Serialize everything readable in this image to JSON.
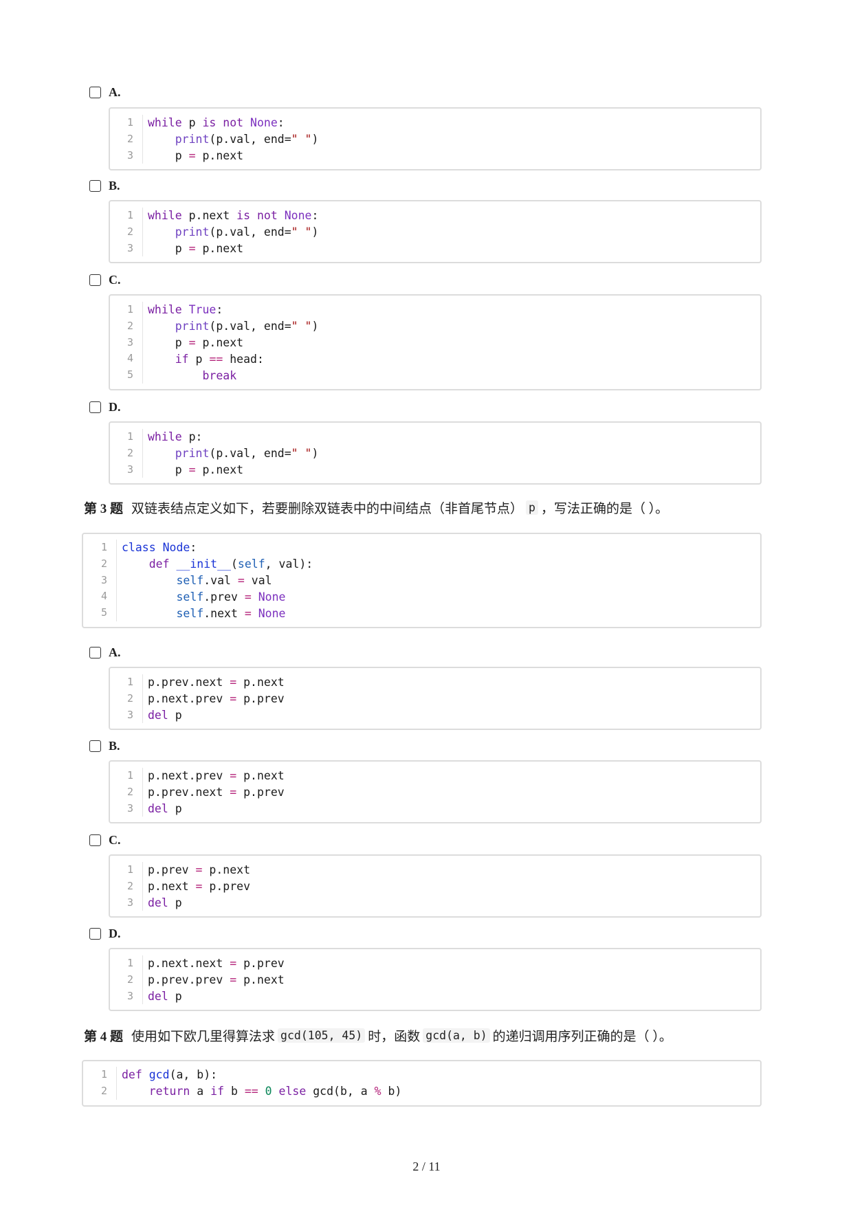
{
  "q2_options": [
    {
      "letter": "A.",
      "lines": [
        "while p is not None:",
        "    print(p.val, end=\" \")",
        "    p = p.next"
      ]
    },
    {
      "letter": "B.",
      "lines": [
        "while p.next is not None:",
        "    print(p.val, end=\" \")",
        "    p = p.next"
      ]
    },
    {
      "letter": "C.",
      "lines": [
        "while True:",
        "    print(p.val, end=\" \")",
        "    p = p.next",
        "    if p == head:",
        "        break"
      ]
    },
    {
      "letter": "D.",
      "lines": [
        "while p:",
        "    print(p.val, end=\" \")",
        "    p = p.next"
      ]
    }
  ],
  "q3": {
    "number": "第 3 题",
    "text_before": "双链表结点定义如下，若要删除双链表中的中间结点（非首尾节点）",
    "inline_code": "p",
    "text_after": "，写法正确的是（ ）。",
    "code": [
      "class Node:",
      "    def __init__(self, val):",
      "        self.val = val",
      "        self.prev = None",
      "        self.next = None"
    ],
    "options": [
      {
        "letter": "A.",
        "lines": [
          "p.prev.next = p.next",
          "p.next.prev = p.prev",
          "del p"
        ]
      },
      {
        "letter": "B.",
        "lines": [
          "p.next.prev = p.next",
          "p.prev.next = p.prev",
          "del p"
        ]
      },
      {
        "letter": "C.",
        "lines": [
          "p.prev = p.next",
          "p.next = p.prev",
          "del p"
        ]
      },
      {
        "letter": "D.",
        "lines": [
          "p.next.next = p.prev",
          "p.prev.prev = p.next",
          "del p"
        ]
      }
    ]
  },
  "q4": {
    "number": "第 4 题",
    "text_1": "使用如下欧几里得算法求",
    "inline_1": "gcd(105, 45)",
    "text_2": "时，函数",
    "inline_2": "gcd(a, b)",
    "text_3": "的递归调用序列正确的是（ ）。",
    "code": [
      "def gcd(a, b):",
      "    return a if b == 0 else gcd(b, a % b)"
    ]
  },
  "footer": {
    "page": "2 / 11"
  }
}
